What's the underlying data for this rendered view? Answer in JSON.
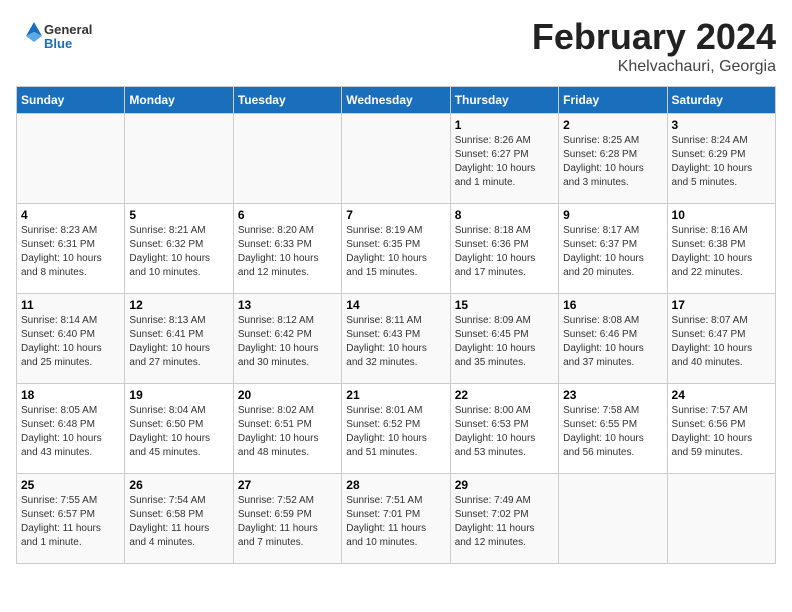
{
  "header": {
    "logo_general": "General",
    "logo_blue": "Blue",
    "month_title": "February 2024",
    "location": "Khelvachauri, Georgia"
  },
  "days_of_week": [
    "Sunday",
    "Monday",
    "Tuesday",
    "Wednesday",
    "Thursday",
    "Friday",
    "Saturday"
  ],
  "weeks": [
    [
      {
        "day": "",
        "info": ""
      },
      {
        "day": "",
        "info": ""
      },
      {
        "day": "",
        "info": ""
      },
      {
        "day": "",
        "info": ""
      },
      {
        "day": "1",
        "info": "Sunrise: 8:26 AM\nSunset: 6:27 PM\nDaylight: 10 hours\nand 1 minute."
      },
      {
        "day": "2",
        "info": "Sunrise: 8:25 AM\nSunset: 6:28 PM\nDaylight: 10 hours\nand 3 minutes."
      },
      {
        "day": "3",
        "info": "Sunrise: 8:24 AM\nSunset: 6:29 PM\nDaylight: 10 hours\nand 5 minutes."
      }
    ],
    [
      {
        "day": "4",
        "info": "Sunrise: 8:23 AM\nSunset: 6:31 PM\nDaylight: 10 hours\nand 8 minutes."
      },
      {
        "day": "5",
        "info": "Sunrise: 8:21 AM\nSunset: 6:32 PM\nDaylight: 10 hours\nand 10 minutes."
      },
      {
        "day": "6",
        "info": "Sunrise: 8:20 AM\nSunset: 6:33 PM\nDaylight: 10 hours\nand 12 minutes."
      },
      {
        "day": "7",
        "info": "Sunrise: 8:19 AM\nSunset: 6:35 PM\nDaylight: 10 hours\nand 15 minutes."
      },
      {
        "day": "8",
        "info": "Sunrise: 8:18 AM\nSunset: 6:36 PM\nDaylight: 10 hours\nand 17 minutes."
      },
      {
        "day": "9",
        "info": "Sunrise: 8:17 AM\nSunset: 6:37 PM\nDaylight: 10 hours\nand 20 minutes."
      },
      {
        "day": "10",
        "info": "Sunrise: 8:16 AM\nSunset: 6:38 PM\nDaylight: 10 hours\nand 22 minutes."
      }
    ],
    [
      {
        "day": "11",
        "info": "Sunrise: 8:14 AM\nSunset: 6:40 PM\nDaylight: 10 hours\nand 25 minutes."
      },
      {
        "day": "12",
        "info": "Sunrise: 8:13 AM\nSunset: 6:41 PM\nDaylight: 10 hours\nand 27 minutes."
      },
      {
        "day": "13",
        "info": "Sunrise: 8:12 AM\nSunset: 6:42 PM\nDaylight: 10 hours\nand 30 minutes."
      },
      {
        "day": "14",
        "info": "Sunrise: 8:11 AM\nSunset: 6:43 PM\nDaylight: 10 hours\nand 32 minutes."
      },
      {
        "day": "15",
        "info": "Sunrise: 8:09 AM\nSunset: 6:45 PM\nDaylight: 10 hours\nand 35 minutes."
      },
      {
        "day": "16",
        "info": "Sunrise: 8:08 AM\nSunset: 6:46 PM\nDaylight: 10 hours\nand 37 minutes."
      },
      {
        "day": "17",
        "info": "Sunrise: 8:07 AM\nSunset: 6:47 PM\nDaylight: 10 hours\nand 40 minutes."
      }
    ],
    [
      {
        "day": "18",
        "info": "Sunrise: 8:05 AM\nSunset: 6:48 PM\nDaylight: 10 hours\nand 43 minutes."
      },
      {
        "day": "19",
        "info": "Sunrise: 8:04 AM\nSunset: 6:50 PM\nDaylight: 10 hours\nand 45 minutes."
      },
      {
        "day": "20",
        "info": "Sunrise: 8:02 AM\nSunset: 6:51 PM\nDaylight: 10 hours\nand 48 minutes."
      },
      {
        "day": "21",
        "info": "Sunrise: 8:01 AM\nSunset: 6:52 PM\nDaylight: 10 hours\nand 51 minutes."
      },
      {
        "day": "22",
        "info": "Sunrise: 8:00 AM\nSunset: 6:53 PM\nDaylight: 10 hours\nand 53 minutes."
      },
      {
        "day": "23",
        "info": "Sunrise: 7:58 AM\nSunset: 6:55 PM\nDaylight: 10 hours\nand 56 minutes."
      },
      {
        "day": "24",
        "info": "Sunrise: 7:57 AM\nSunset: 6:56 PM\nDaylight: 10 hours\nand 59 minutes."
      }
    ],
    [
      {
        "day": "25",
        "info": "Sunrise: 7:55 AM\nSunset: 6:57 PM\nDaylight: 11 hours\nand 1 minute."
      },
      {
        "day": "26",
        "info": "Sunrise: 7:54 AM\nSunset: 6:58 PM\nDaylight: 11 hours\nand 4 minutes."
      },
      {
        "day": "27",
        "info": "Sunrise: 7:52 AM\nSunset: 6:59 PM\nDaylight: 11 hours\nand 7 minutes."
      },
      {
        "day": "28",
        "info": "Sunrise: 7:51 AM\nSunset: 7:01 PM\nDaylight: 11 hours\nand 10 minutes."
      },
      {
        "day": "29",
        "info": "Sunrise: 7:49 AM\nSunset: 7:02 PM\nDaylight: 11 hours\nand 12 minutes."
      },
      {
        "day": "",
        "info": ""
      },
      {
        "day": "",
        "info": ""
      }
    ]
  ]
}
